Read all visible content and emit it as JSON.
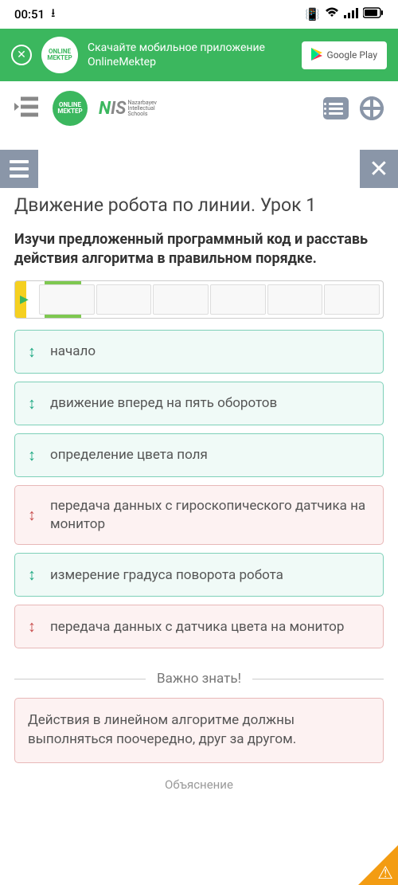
{
  "status": {
    "time": "00:51",
    "vibrate": "📳",
    "wifi": "📶",
    "signal": "📶",
    "battery": "🔲"
  },
  "banner": {
    "logo": "ONLINE\nMEKTEP",
    "text": "Скачайте мобильное приложение OnlineMektep",
    "store": "Google Play"
  },
  "brand": {
    "logo": "ONLINE\nMEKTEP",
    "nis_n": "N",
    "nis_is": "IS",
    "nis_sub": "Nazarbayev\nIntellectual\nSchools"
  },
  "title": "Движение робота по линии. Урок 1",
  "instruction": "Изучи предложенный программный код и расставь действия алгоритма в правильном порядке.",
  "items": [
    {
      "text": "начало",
      "state": "green"
    },
    {
      "text": "движение вперед на пять оборотов",
      "state": "green"
    },
    {
      "text": "определение цвета поля",
      "state": "green"
    },
    {
      "text": "передача данных с гироскопического датчика на монитор",
      "state": "red"
    },
    {
      "text": "измерение градуса поворота робота",
      "state": "green"
    },
    {
      "text": "передача данных с датчика цвета на монитор",
      "state": "red"
    }
  ],
  "divider": "Важно знать!",
  "note": "Действия в линейном алгоритме должны выполняться поочередно, друг за другом.",
  "truncated": "Объяснение"
}
